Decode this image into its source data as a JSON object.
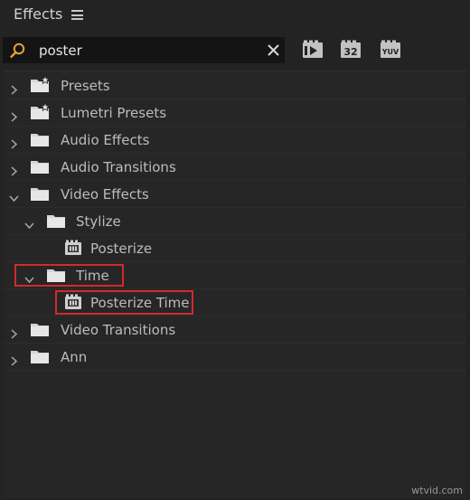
{
  "panel": {
    "title": "Effects"
  },
  "search": {
    "value": "poster"
  },
  "toolbar": {
    "buttons": [
      {
        "name": "accelerated-effects-filter",
        "icon": "accelerated-effects-icon"
      },
      {
        "name": "32-bit-filter",
        "icon": "32-bit-icon",
        "label": "32"
      },
      {
        "name": "yuv-filter",
        "icon": "yuv-icon",
        "label": "YUV"
      }
    ]
  },
  "tree": {
    "items": [
      {
        "label": "Presets",
        "type": "preset-folder",
        "level": 0,
        "expanded": false
      },
      {
        "label": "Lumetri Presets",
        "type": "preset-folder",
        "level": 0,
        "expanded": false
      },
      {
        "label": "Audio Effects",
        "type": "folder",
        "level": 0,
        "expanded": false
      },
      {
        "label": "Audio Transitions",
        "type": "folder",
        "level": 0,
        "expanded": false
      },
      {
        "label": "Video Effects",
        "type": "folder",
        "level": 0,
        "expanded": true
      },
      {
        "label": "Stylize",
        "type": "folder",
        "level": 1,
        "expanded": true
      },
      {
        "label": "Posterize",
        "type": "effect",
        "level": 2
      },
      {
        "label": "Time",
        "type": "folder",
        "level": 1,
        "expanded": true,
        "highlighted": true
      },
      {
        "label": "Posterize Time",
        "type": "effect",
        "level": 2,
        "highlighted": true
      },
      {
        "label": "Video Transitions",
        "type": "folder",
        "level": 0,
        "expanded": false
      },
      {
        "label": "Ann",
        "type": "folder",
        "level": 0,
        "expanded": false
      }
    ]
  },
  "watermark": "wtvid.com",
  "colors": {
    "highlight": "#d22a2a",
    "search_icon": "#e8a33a",
    "background": "#232323"
  }
}
